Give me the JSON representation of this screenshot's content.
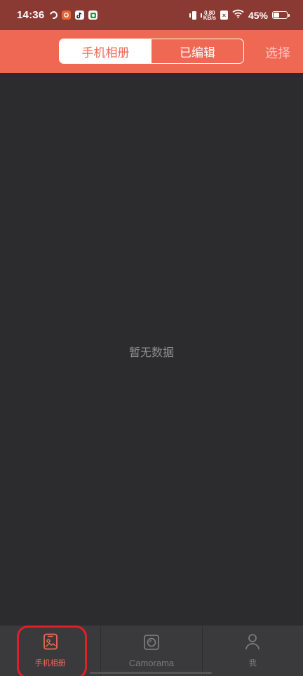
{
  "status_bar": {
    "time": "14:36",
    "app_icons": [
      "orbit-icon",
      "app-badge-icon",
      "tiktok-icon",
      "green-app-icon"
    ],
    "net_speed_value": "0.80",
    "net_speed_unit": "KB/s",
    "battery_percent": "45%",
    "battery_level": 0.45
  },
  "header": {
    "tabs": [
      {
        "label": "手机相册",
        "active": true
      },
      {
        "label": "已编辑",
        "active": false
      }
    ],
    "select_label": "选择"
  },
  "content": {
    "empty_text": "暂无数据"
  },
  "bottom_nav": {
    "items": [
      {
        "label": "手机相册",
        "icon": "phone-gallery-icon",
        "active": true
      },
      {
        "label": "Camorama",
        "icon": "camera-icon",
        "active": false
      },
      {
        "label": "我",
        "icon": "person-icon",
        "active": false
      }
    ]
  },
  "colors": {
    "accent": "#ef6854",
    "status_bar": "#8b3a33",
    "background": "#2c2c2e",
    "nav_background": "#3a3a3c",
    "highlight": "#e01f26"
  }
}
